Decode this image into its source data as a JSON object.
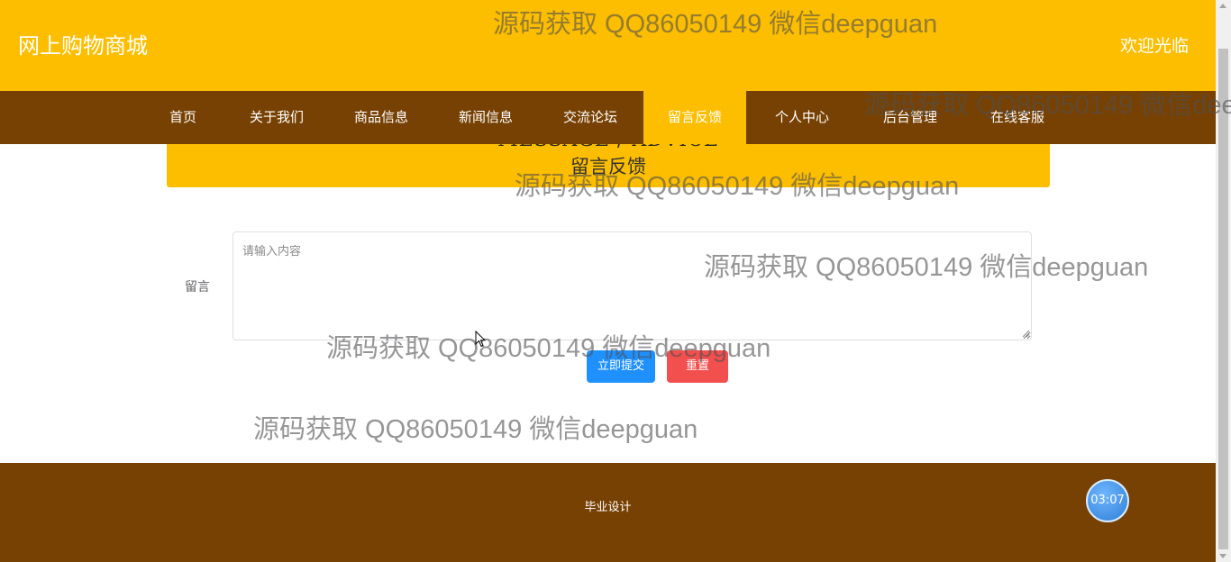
{
  "header": {
    "site_title": "网上购物商城",
    "welcome": "欢迎光临",
    "bg_color": "#fdbe00"
  },
  "nav": {
    "bg_color": "#774103",
    "active_color": "#fdbe00",
    "items": [
      {
        "label": "首页"
      },
      {
        "label": "关于我们"
      },
      {
        "label": "商品信息"
      },
      {
        "label": "新闻信息"
      },
      {
        "label": "交流论坛"
      },
      {
        "label": "留言反馈",
        "active": true
      },
      {
        "label": "个人中心"
      },
      {
        "label": "后台管理"
      },
      {
        "label": "在线客服"
      }
    ]
  },
  "banner": {
    "title_en": "MESSAGE / ADVICE",
    "title_cn": "留言反馈"
  },
  "form": {
    "label": "留言",
    "placeholder": "请输入内容",
    "value": "",
    "submit_label": "立即提交",
    "reset_label": "重置",
    "submit_color": "#1e90ff",
    "reset_color": "#f24f4f"
  },
  "footer": {
    "text": "毕业设计",
    "bg_color": "#774103"
  },
  "clock": {
    "time": "03:07"
  },
  "watermark": {
    "text": "源码获取 QQ86050149 微信deepguan"
  }
}
